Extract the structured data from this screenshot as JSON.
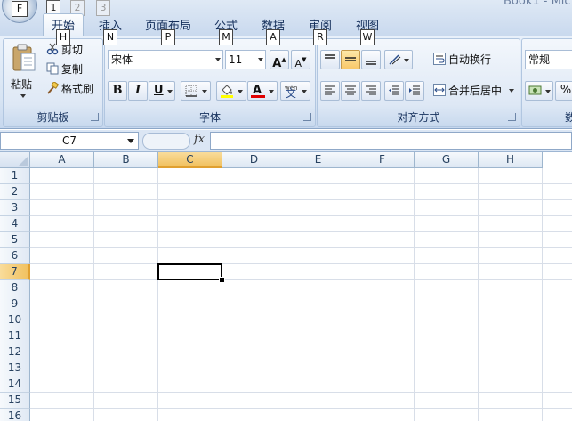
{
  "title": {
    "text": "Book1 - Mic"
  },
  "office_button": {
    "key_tip": "F"
  },
  "quick_access": {
    "key_tips": [
      "1",
      "2",
      "3"
    ]
  },
  "tabs": [
    {
      "label": "开始",
      "key_tip": "H"
    },
    {
      "label": "插入",
      "key_tip": "N"
    },
    {
      "label": "页面布局",
      "key_tip": "P"
    },
    {
      "label": "公式",
      "key_tip": "M"
    },
    {
      "label": "数据",
      "key_tip": "A"
    },
    {
      "label": "审阅",
      "key_tip": "R"
    },
    {
      "label": "视图",
      "key_tip": "W"
    }
  ],
  "ribbon": {
    "clipboard": {
      "label": "剪贴板",
      "paste": "粘贴",
      "cut": "剪切",
      "copy": "复制",
      "format_painter": "格式刷"
    },
    "font": {
      "label": "字体",
      "font_name": "宋体",
      "font_size": "11",
      "grow": "A",
      "shrink": "A",
      "bold": "B",
      "italic": "I",
      "underline": "U",
      "font_color_glyph": "A",
      "phonetic_glyph": "wén",
      "phonetic_char": "文"
    },
    "alignment": {
      "label": "对齐方式",
      "wrap_text": "自动换行",
      "merge_center": "合并后居中"
    },
    "number": {
      "label": "数",
      "format": "常规",
      "percent": "%"
    }
  },
  "formula_bar": {
    "name_box": "C7",
    "fx": "fx",
    "content": ""
  },
  "sheet": {
    "columns": [
      "A",
      "B",
      "C",
      "D",
      "E",
      "F",
      "G",
      "H"
    ],
    "rows": [
      "1",
      "2",
      "3",
      "4",
      "5",
      "6",
      "7",
      "8",
      "9",
      "10",
      "11",
      "12",
      "13",
      "14",
      "15",
      "16"
    ],
    "active_column": "C",
    "active_row": "7"
  },
  "colors": {
    "selected_header": "#f1c15f",
    "ribbon_bg": "#dbe6f4"
  }
}
